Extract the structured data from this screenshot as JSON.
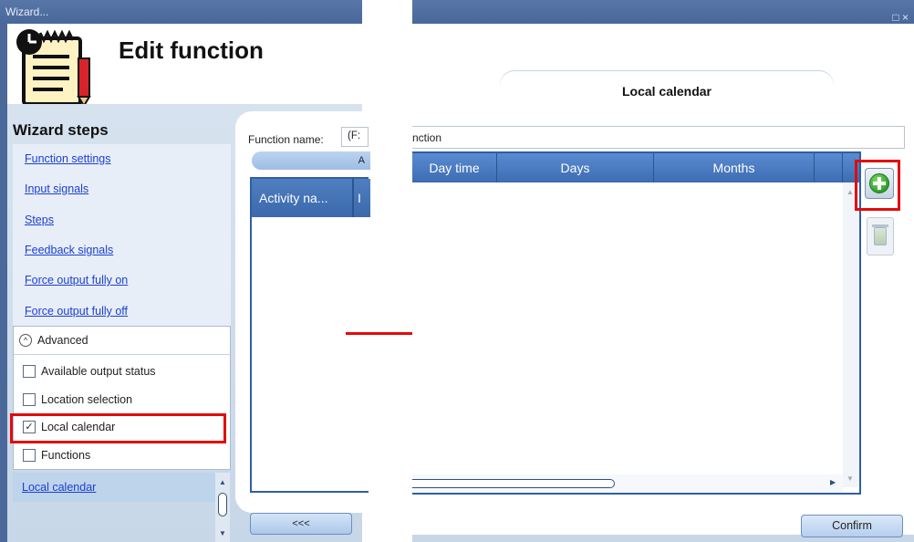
{
  "left_window": {
    "title": "Wizard...",
    "header": {
      "title": "Edit function",
      "icon": "calendar-clock-pencil-icon"
    },
    "wizard_steps": {
      "title": "Wizard steps",
      "items": [
        {
          "label": "Function settings"
        },
        {
          "label": "Input signals"
        },
        {
          "label": "Steps"
        },
        {
          "label": "Feedback signals"
        },
        {
          "label": "Force output fully on"
        },
        {
          "label": "Force output fully off"
        }
      ]
    },
    "advanced": {
      "label": "Advanced",
      "options": [
        {
          "label": "Available output status",
          "checked": false
        },
        {
          "label": "Location selection",
          "checked": false
        },
        {
          "label": "Local calendar",
          "checked": true,
          "highlighted": true
        },
        {
          "label": "Functions",
          "checked": false
        }
      ]
    },
    "added_step": {
      "label": "Local calendar"
    },
    "function_name_label": "Function name:",
    "function_name_value": "(F:",
    "tab_partial": "A",
    "grid_first_column": "Activity na...",
    "grid_second_column_partial": "I",
    "back_button": "<<<"
  },
  "right_window": {
    "window_controls": "□ ×",
    "tab": "Local calendar",
    "function_name_value": "nction",
    "columns": [
      "Day time",
      "Days",
      "Months"
    ],
    "add_button_icon": "add-green-plus-icon",
    "delete_button_icon": "recycle-bin-icon",
    "confirm_button": "Confirm"
  },
  "colors": {
    "highlight_red": "#e30a0a",
    "grid_header_blue": "#3d6cb2",
    "link_blue": "#1c3fd0",
    "title_bar": "#4a6899"
  }
}
